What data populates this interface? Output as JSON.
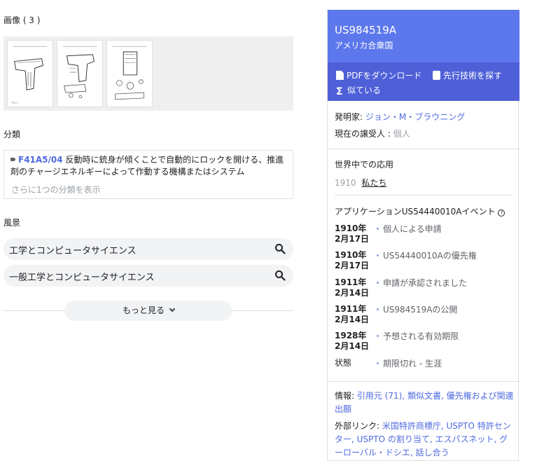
{
  "images": {
    "title": "画像 ( 3 )",
    "thumbnails": [
      "patent-drawing-1",
      "patent-drawing-2",
      "patent-drawing-3"
    ]
  },
  "classification": {
    "title": "分類",
    "code": "F41A5/04",
    "description": "反動時に銃身が傾くことで自動的にロックを開ける、推進剤のチャージエネルギーによって作動する機構またはシステム",
    "more": "さらに1つの分類を表示"
  },
  "landscape": {
    "title": "風景",
    "items": [
      "工学とコンピュータサイエンス",
      "一般工学とコンピュータサイエンス"
    ],
    "more_label": "もっと見る"
  },
  "patent": {
    "number": "US984519A",
    "country": "アメリカ合衆国",
    "accent": "#5d78ec",
    "actions": {
      "pdf": "PDFをダウンロード",
      "prior_art": "先行技術を探す",
      "similar": "似ている"
    },
    "inventor_label": "発明家:",
    "inventor": "ジョン・M・ブラウニング",
    "assignee_label": "現在の譲受人 :",
    "assignee": "個人",
    "worldwide_title": "世界中での応用",
    "worldwide_year": "1910",
    "worldwide_link": "私たち",
    "events_title": "アプリケーションUS54440010Aイベント",
    "events": [
      {
        "date": "1910年2月17日",
        "text": "個人による申請"
      },
      {
        "date": "1910年2月17日",
        "text": "US54440010Aの優先権"
      },
      {
        "date": "1911年2月14日",
        "text": "申請が承認されました"
      },
      {
        "date": "1911年2月14日",
        "text": "US984519Aの公開"
      },
      {
        "date": "1928年2月14日",
        "text": "予想される有効期限"
      },
      {
        "date": "状態",
        "text": "期限切れ - 生涯"
      }
    ],
    "info_label": "情報:",
    "info_links": "引用元 (71), 類似文書, 優先権および関連出願",
    "external_label": "外部リンク:",
    "external_links": "米国特許商標庁, USPTO 特許センター, USPTO の割り当て, エスパスネット, グーローバル・ドシエ, 話し合う"
  }
}
